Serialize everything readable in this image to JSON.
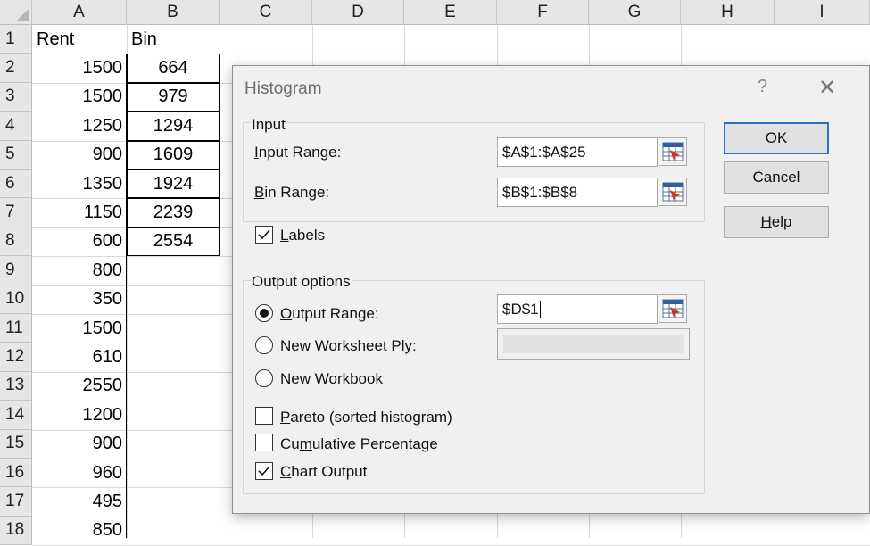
{
  "sheet": {
    "columns": [
      "A",
      "B",
      "C",
      "D",
      "E",
      "F",
      "G",
      "H",
      "I"
    ],
    "rows": [
      "1",
      "2",
      "3",
      "4",
      "5",
      "6",
      "7",
      "8",
      "9",
      "10",
      "11",
      "12",
      "13",
      "14",
      "15",
      "16",
      "17",
      "18"
    ],
    "header_a": "Rent",
    "header_b": "Bin",
    "rent": [
      "1500",
      "1500",
      "1250",
      "900",
      "1350",
      "1150",
      "600",
      "800",
      "350",
      "1500",
      "610",
      "2550",
      "1200",
      "900",
      "960",
      "495",
      "850"
    ],
    "bin": [
      "664",
      "979",
      "1294",
      "1609",
      "1924",
      "2239",
      "2554"
    ]
  },
  "dialog": {
    "title": "Histogram",
    "help_glyph": "?",
    "close_glyph": "✕",
    "input": {
      "group_label": "Input",
      "input_range_label": "nput Range:",
      "input_range_accel": "I",
      "input_range_value": "$A$1:$A$25",
      "bin_range_label": "in Range:",
      "bin_range_accel": "B",
      "bin_range_value": "$B$1:$B$8"
    },
    "labels_check": {
      "accel": "L",
      "label": "abels",
      "checked": true
    },
    "output": {
      "group_label": "Output options",
      "output_range_accel": "O",
      "output_range_label": "utput Range:",
      "output_range_value": "$D$1",
      "new_ws_pre": "New Worksheet ",
      "new_ws_accel": "P",
      "new_ws_post": "ly:",
      "new_wb_pre": "New ",
      "new_wb_accel": "W",
      "new_wb_post": "orkbook",
      "pareto_accel": "P",
      "pareto_label": "areto (sorted histogram)",
      "cumulative_pre": "Cu",
      "cumulative_accel": "m",
      "cumulative_post": "ulative Percentage",
      "chart_accel": "C",
      "chart_label": "hart Output",
      "pareto_checked": false,
      "cumulative_checked": false,
      "chart_checked": true
    },
    "buttons": {
      "ok": "OK",
      "cancel": "Cancel",
      "help_accel": "H",
      "help_rest": "elp"
    },
    "picker_icon": "range-selector-icon"
  },
  "colors": {
    "accent": "#2b74c7",
    "dialog_bg": "#f0f0f0",
    "header_bg": "#e6e6e6"
  }
}
